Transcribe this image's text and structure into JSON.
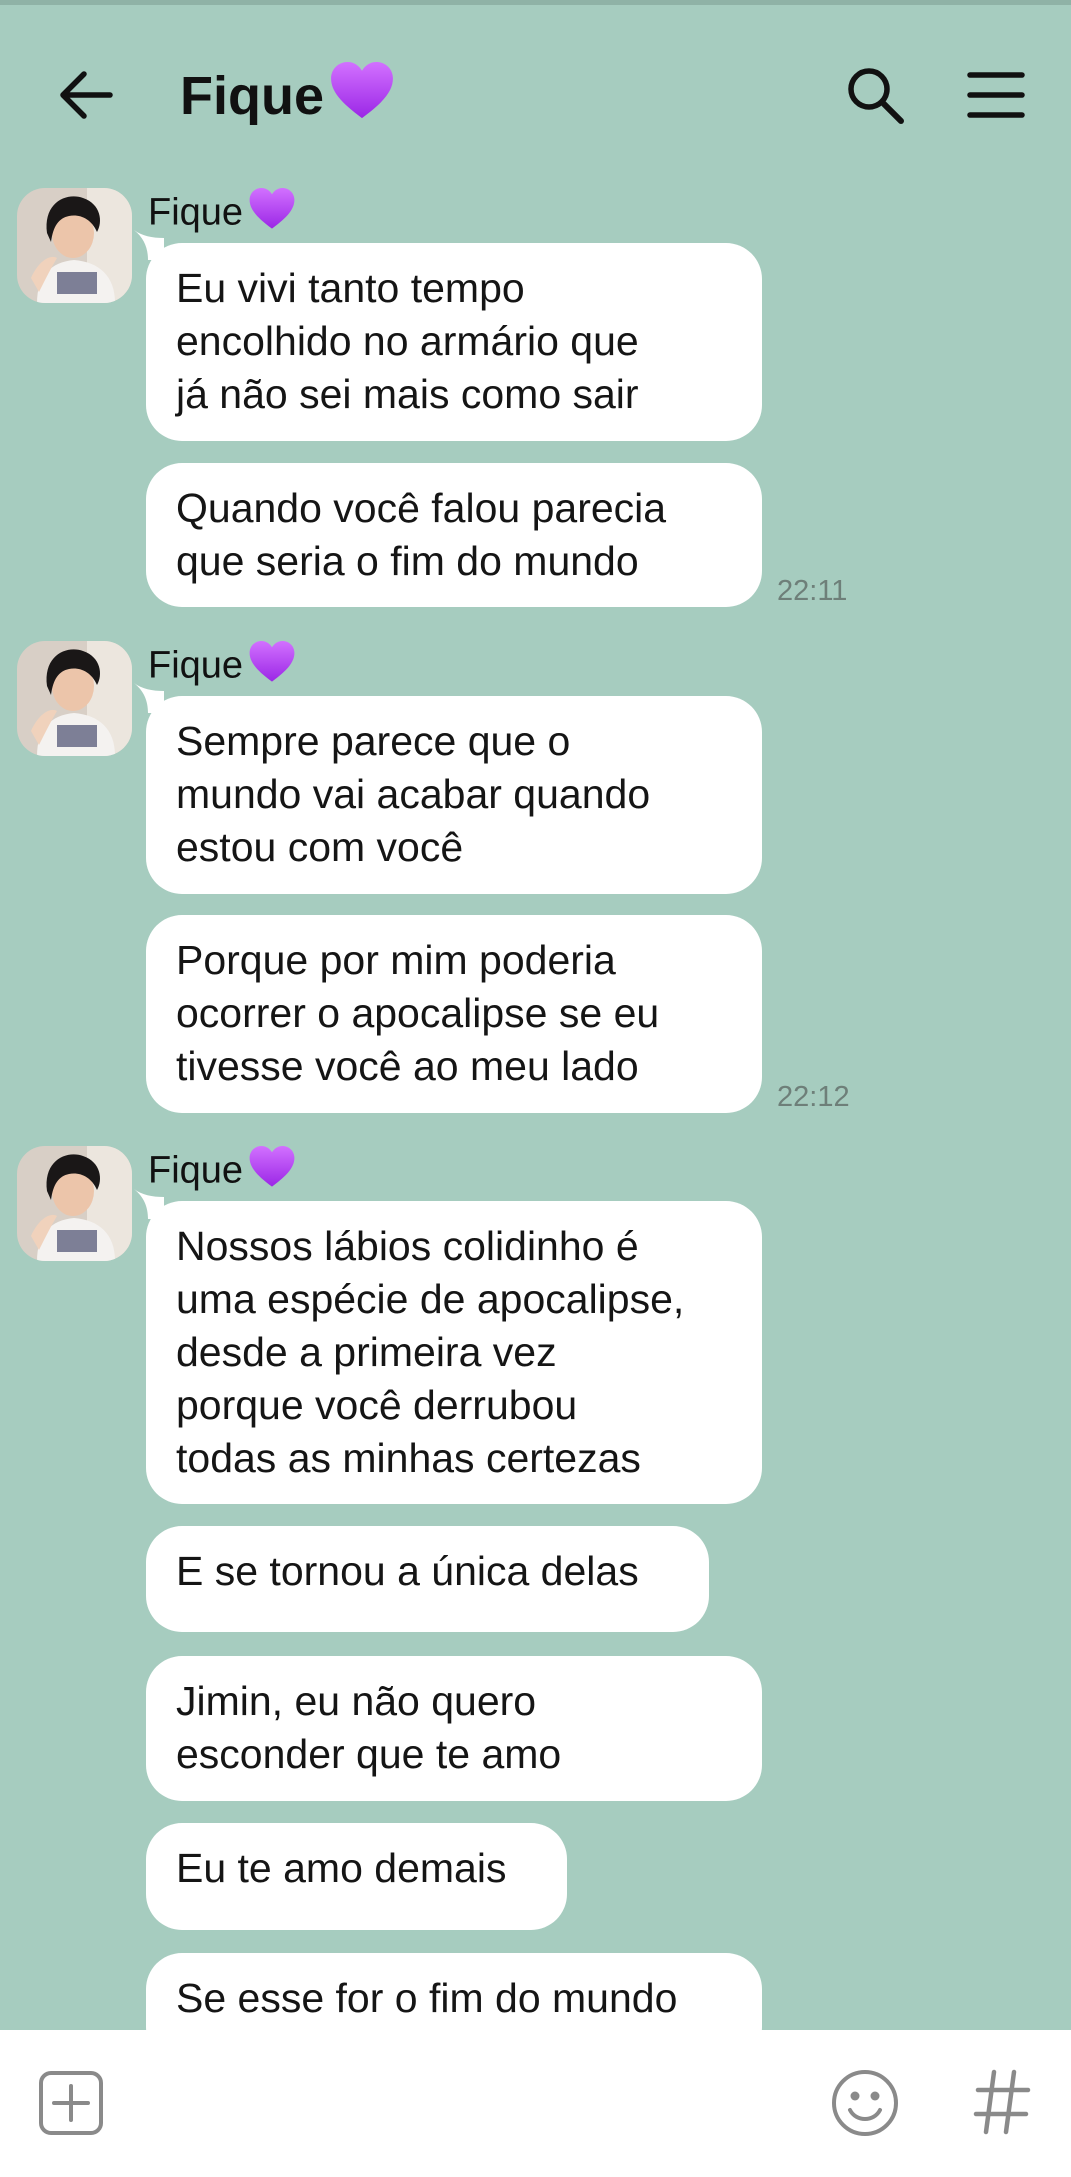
{
  "header": {
    "title": "Fique"
  },
  "messages": [
    {
      "sender": "Fique",
      "text": "Eu vivi tanto tempo\nencolhido no armário que\njá não sei mais como sair"
    },
    {
      "text": "Quando você falou parecia\nque seria o fim do mundo",
      "time": "22:11"
    },
    {
      "sender": "Fique",
      "text": "Sempre parece que o\nmundo vai acabar quando\nestou com você"
    },
    {
      "text": "Porque por mim poderia\nocorrer o apocalipse se eu\ntivesse você ao meu lado",
      "time": "22:12"
    },
    {
      "sender": "Fique",
      "text": "Nossos lábios colidinho é\numa espécie de apocalipse,\ndesde a primeira vez\nporque você derrubou\ntodas as minhas certezas"
    },
    {
      "text": "E se tornou a única delas"
    },
    {
      "text": "Jimin, eu não quero\nesconder que te amo"
    },
    {
      "text": "Eu te amo demais"
    },
    {
      "text": "Se esse for o fim do mundo"
    }
  ],
  "icons": {
    "back": "arrow-left-icon",
    "search": "search-icon",
    "menu": "hamburger-menu-icon",
    "heart": "purple-heart-icon",
    "attach": "plus-square-icon",
    "emoji": "smiley-icon",
    "hashtag": "hashtag-icon"
  },
  "colors": {
    "background": "#a6ccbf",
    "bubble": "#ffffff",
    "heart": "#b43cf0",
    "time": "#6e7f79"
  }
}
